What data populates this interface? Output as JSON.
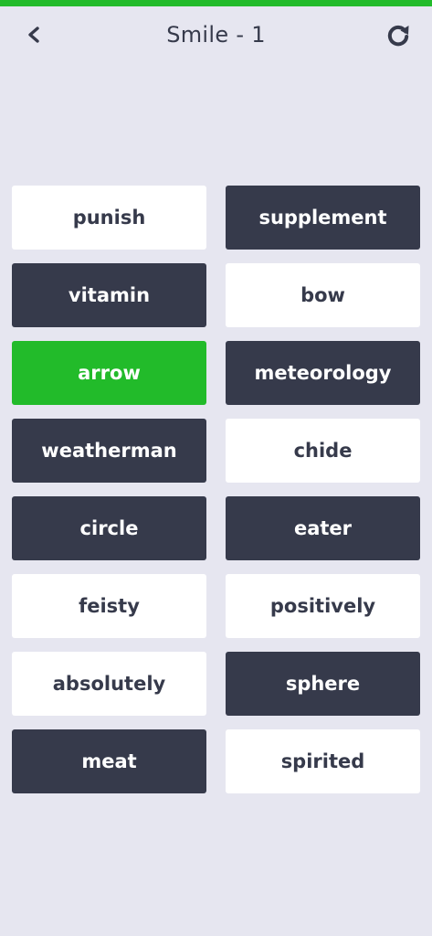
{
  "progress": {
    "percent": 100,
    "color": "#22bb2a"
  },
  "header": {
    "title": "Smile - 1",
    "back_icon": "chevron-left-icon",
    "reload_icon": "reload-icon"
  },
  "colors": {
    "background": "#e6e6f0",
    "dark_tile": "#363a4b",
    "light_tile": "#ffffff",
    "selected_tile": "#22bb2a"
  },
  "tiles": [
    {
      "label": "punish",
      "style": "light"
    },
    {
      "label": "supplement",
      "style": "dark"
    },
    {
      "label": "vitamin",
      "style": "dark"
    },
    {
      "label": "bow",
      "style": "light"
    },
    {
      "label": "arrow",
      "style": "green"
    },
    {
      "label": "meteorology",
      "style": "dark"
    },
    {
      "label": "weatherman",
      "style": "dark"
    },
    {
      "label": "chide",
      "style": "light"
    },
    {
      "label": "circle",
      "style": "dark"
    },
    {
      "label": "eater",
      "style": "dark"
    },
    {
      "label": "feisty",
      "style": "light"
    },
    {
      "label": "positively",
      "style": "light"
    },
    {
      "label": "absolutely",
      "style": "light"
    },
    {
      "label": "sphere",
      "style": "dark"
    },
    {
      "label": "meat",
      "style": "dark"
    },
    {
      "label": "spirited",
      "style": "light"
    }
  ]
}
